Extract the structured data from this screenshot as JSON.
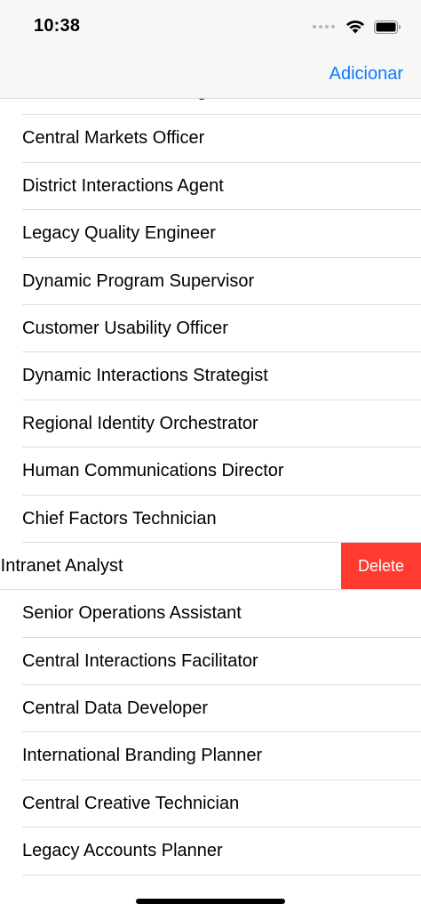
{
  "status_bar": {
    "time": "10:38",
    "icons": [
      "cellular-signal-icon",
      "wifi-icon",
      "battery-icon"
    ]
  },
  "nav": {
    "add_label": "Adicionar"
  },
  "list": {
    "top_clipped_item": "Central Markets Manager",
    "items": [
      "Central Markets Officer",
      "District Interactions Agent",
      "Legacy Quality Engineer",
      "Dynamic Program Supervisor",
      "Customer Usability Officer",
      "Dynamic Interactions Strategist",
      "Regional Identity Orchestrator",
      "Human Communications Director",
      "Chief Factors Technician",
      "d Intranet Analyst",
      "Senior Operations Assistant",
      "Central Interactions Facilitator",
      "Central Data Developer",
      "International Branding Planner",
      "Central Creative Technician",
      "Legacy Accounts Planner"
    ],
    "swiped_row_index": 9,
    "delete_label": "Delete"
  },
  "colors": {
    "accent": "#0a7aff",
    "destructive": "#ff3b30",
    "separator": "#dcdcdc",
    "nav_background": "#f7f7f7"
  }
}
